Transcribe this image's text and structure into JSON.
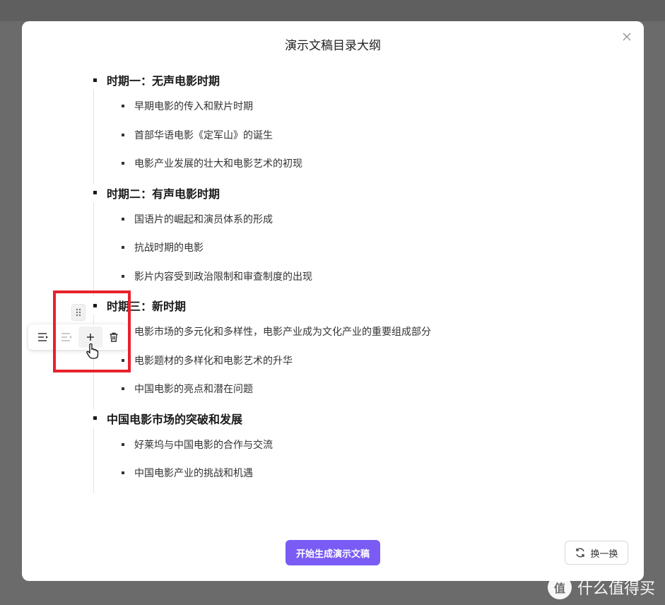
{
  "modal": {
    "title": "演示文稿目录大纲"
  },
  "outline": [
    {
      "title": "时期一：无声电影时期",
      "items": [
        "早期电影的传入和默片时期",
        "首部华语电影《定军山》的诞生",
        "电影产业发展的壮大和电影艺术的初现"
      ]
    },
    {
      "title": "时期二：有声电影时期",
      "items": [
        "国语片的崛起和演员体系的形成",
        "抗战时期的电影",
        "影片内容受到政治限制和审查制度的出现"
      ]
    },
    {
      "title": "时期三：新时期",
      "items": [
        "电影市场的多元化和多样性，电影产业成为文化产业的重要组成部分",
        "电影题材的多样化和电影艺术的升华",
        "中国电影的亮点和潜在问题"
      ]
    },
    {
      "title": "中国电影市场的突破和发展",
      "items": [
        "好莱坞与中国电影的合作与交流",
        "中国电影产业的挑战和机遇"
      ]
    }
  ],
  "toolbar": {
    "icons": [
      "indent-icon",
      "outdent-icon",
      "plus-icon",
      "trash-icon"
    ]
  },
  "footer": {
    "generate_label": "开始生成演示文稿",
    "refresh_label": "换一换"
  },
  "watermark": {
    "logo": "值",
    "text": "什么值得买"
  },
  "colors": {
    "primary": "#7a5cf5",
    "highlight": "#e8222c",
    "backdrop": "#6b6b6b"
  }
}
